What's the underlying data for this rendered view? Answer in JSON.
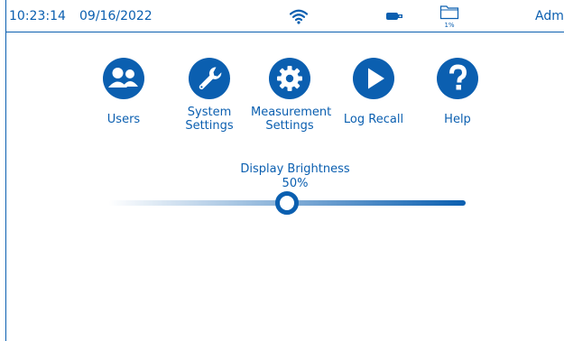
{
  "status_bar": {
    "time": "10:23:14",
    "date": "09/16/2022",
    "wifi_icon": "wifi-icon",
    "usb_icon": "usb-drive-icon",
    "storage_icon": "folder-icon",
    "storage_percent": "1%",
    "user": "Admin"
  },
  "menu": [
    {
      "label": "Users",
      "icon": "users-icon"
    },
    {
      "label": "System Settings",
      "line1": "System",
      "line2": "Settings",
      "icon": "wrench-icon"
    },
    {
      "label": "Measurement Settings",
      "line1": "Measurement",
      "line2": "Settings",
      "icon": "gear-icon"
    },
    {
      "label": "Log Recall",
      "icon": "play-icon"
    },
    {
      "label": "Help",
      "icon": "question-icon"
    }
  ],
  "brightness": {
    "title": "Display Brightness",
    "value_text": "50%",
    "value": 0.5
  },
  "colors": {
    "accent": "#0b5fb0",
    "background": "#ffffff"
  }
}
